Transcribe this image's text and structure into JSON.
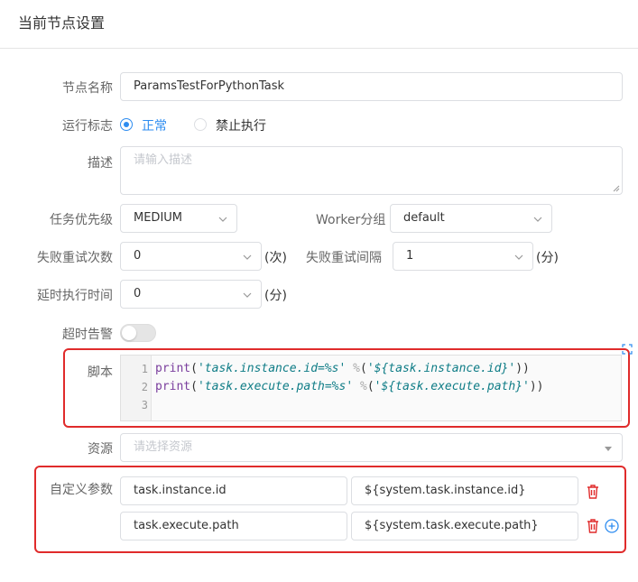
{
  "header": {
    "title": "当前节点设置"
  },
  "node_name": {
    "label": "节点名称",
    "value": "ParamsTestForPythonTask"
  },
  "run_flag": {
    "label": "运行标志",
    "options": [
      "正常",
      "禁止执行"
    ],
    "selected": "正常"
  },
  "description": {
    "label": "描述",
    "placeholder": "请输入描述"
  },
  "priority": {
    "label": "任务优先级",
    "value": "MEDIUM"
  },
  "worker_group": {
    "label": "Worker分组",
    "value": "default"
  },
  "retry_times": {
    "label": "失败重试次数",
    "value": "0",
    "unit": "(次)"
  },
  "retry_interval": {
    "label": "失败重试间隔",
    "value": "1",
    "unit": "(分)"
  },
  "delay_time": {
    "label": "延时执行时间",
    "value": "0",
    "unit": "(分)"
  },
  "timeout_alarm": {
    "label": "超时告警",
    "enabled": false
  },
  "script": {
    "label": "脚本",
    "line_numbers": [
      "1",
      "2",
      "3"
    ],
    "lines": [
      {
        "fn": "print",
        "open": "(",
        "str": "'task.instance.id=%s'",
        "op": " %",
        "open2": "(",
        "arg": "'${task.instance.id}'",
        "close": "))"
      },
      {
        "fn": "print",
        "open": "(",
        "str": "'task.execute.path=%s'",
        "op": " %",
        "open2": "(",
        "arg": "'${task.execute.path}'",
        "close": "))"
      }
    ]
  },
  "resource": {
    "label": "资源",
    "placeholder": "请选择资源"
  },
  "custom_params": {
    "label": "自定义参数",
    "rows": [
      {
        "key": "task.instance.id",
        "value": "${system.task.instance.id}"
      },
      {
        "key": "task.execute.path",
        "value": "${system.task.execute.path}"
      }
    ]
  },
  "colors": {
    "accent": "#2d8cf0",
    "highlight_box": "#e02b2b",
    "delete": "#e02b2b",
    "add": "#2d8cf0"
  }
}
